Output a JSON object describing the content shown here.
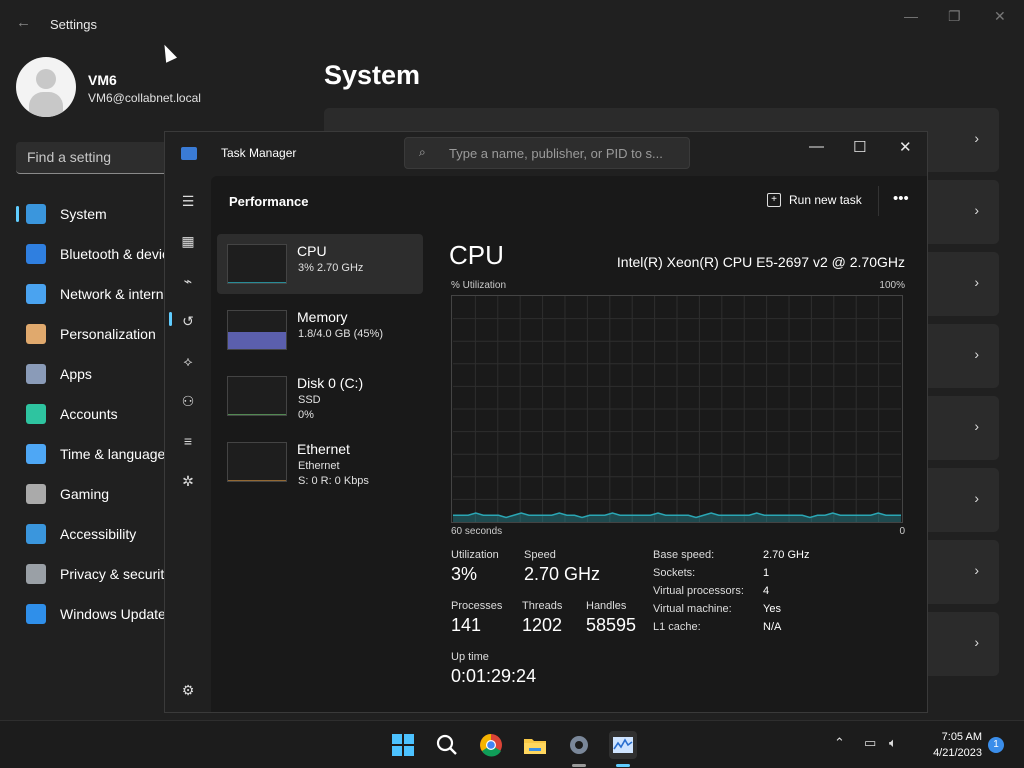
{
  "settings": {
    "window_title": "Settings",
    "user": {
      "name": "VM6",
      "email": "VM6@collabnet.local"
    },
    "search_placeholder": "Find a setting",
    "page_title": "System",
    "nav": [
      {
        "label": "System",
        "icon": "monitor-icon",
        "color": "#3a96dd"
      },
      {
        "label": "Bluetooth & devices",
        "icon": "bluetooth-icon",
        "color": "#2f7fe0"
      },
      {
        "label": "Network & internet",
        "icon": "wifi-icon",
        "color": "#4aa3f0"
      },
      {
        "label": "Personalization",
        "icon": "brush-icon",
        "color": "#e0a96d"
      },
      {
        "label": "Apps",
        "icon": "apps-icon",
        "color": "#8a9bb8"
      },
      {
        "label": "Accounts",
        "icon": "person-icon",
        "color": "#2ec4a0"
      },
      {
        "label": "Time & language",
        "icon": "clock-globe-icon",
        "color": "#4ea7f5"
      },
      {
        "label": "Gaming",
        "icon": "gamepad-icon",
        "color": "#aaaaaa"
      },
      {
        "label": "Accessibility",
        "icon": "accessibility-icon",
        "color": "#3a96dd"
      },
      {
        "label": "Privacy & security",
        "icon": "shield-icon",
        "color": "#9aa0a6"
      },
      {
        "label": "Windows Update",
        "icon": "update-icon",
        "color": "#2f8fea"
      }
    ],
    "chevron": "›"
  },
  "task_manager": {
    "title": "Task Manager",
    "search_placeholder": "Type a name, publisher, or PID to s...",
    "section_title": "Performance",
    "run_new_task": "Run new task",
    "more": "•••",
    "resources": [
      {
        "name": "CPU",
        "line1": "3%  2.70 GHz",
        "line2": "",
        "color": "#2aa6b4",
        "level": 0.03
      },
      {
        "name": "Memory",
        "line1": "1.8/4.0 GB (45%)",
        "line2": "",
        "color": "#6a6fd1",
        "level": 0.45
      },
      {
        "name": "Disk 0 (C:)",
        "line1": "SSD",
        "line2": "0%",
        "color": "#5fa35f",
        "level": 0.0
      },
      {
        "name": "Ethernet",
        "line1": "Ethernet",
        "line2": "S: 0  R: 0 Kbps",
        "color": "#b07c3a",
        "level": 0.0
      }
    ],
    "cpu": {
      "heading": "CPU",
      "model": "Intel(R) Xeon(R) CPU E5-2697 v2 @ 2.70GHz",
      "util_label": "% Utilization",
      "util_max": "100%",
      "time_label": "60 seconds",
      "time_end": "0",
      "graph_color": "#2aa6b4",
      "stats": {
        "utilization_label": "Utilization",
        "utilization": "3%",
        "speed_label": "Speed",
        "speed": "2.70 GHz",
        "processes_label": "Processes",
        "processes": "141",
        "threads_label": "Threads",
        "threads": "1202",
        "handles_label": "Handles",
        "handles": "58595",
        "uptime_label": "Up time",
        "uptime": "0:01:29:24"
      },
      "details": [
        {
          "k": "Base speed:",
          "v": "2.70 GHz"
        },
        {
          "k": "Sockets:",
          "v": "1"
        },
        {
          "k": "Virtual processors:",
          "v": "4"
        },
        {
          "k": "Virtual machine:",
          "v": "Yes"
        },
        {
          "k": "L1 cache:",
          "v": "N/A"
        }
      ],
      "history_percent": [
        3,
        3,
        3,
        4,
        3,
        3,
        3,
        2,
        3,
        4,
        3,
        3,
        3,
        3,
        4,
        3,
        3,
        2,
        3,
        3,
        3,
        4,
        3,
        3,
        3,
        3,
        3,
        4,
        3,
        3,
        3,
        3,
        2,
        3,
        4,
        3,
        3,
        3,
        3,
        3,
        4,
        3,
        3,
        3,
        3,
        3,
        3,
        2,
        3,
        3,
        4,
        3,
        3,
        3,
        3,
        3,
        4,
        3,
        3,
        3
      ]
    }
  },
  "taskbar": {
    "time": "7:05 AM",
    "date": "4/21/2023",
    "notification_count": "1",
    "apps": [
      "start-icon",
      "search-icon",
      "chrome-icon",
      "file-explorer-icon",
      "settings-icon",
      "task-manager-icon"
    ]
  }
}
